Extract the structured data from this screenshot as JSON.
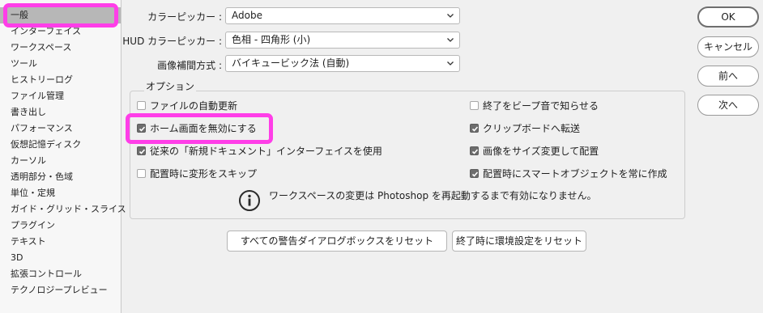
{
  "sidebar": {
    "items": [
      {
        "label": "一般",
        "selected": true
      },
      {
        "label": "インターフェイス"
      },
      {
        "label": "ワークスペース"
      },
      {
        "label": "ツール"
      },
      {
        "label": "ヒストリーログ"
      },
      {
        "label": "ファイル管理"
      },
      {
        "label": "書き出し"
      },
      {
        "label": "パフォーマンス"
      },
      {
        "label": "仮想記憶ディスク"
      },
      {
        "label": "カーソル"
      },
      {
        "label": "透明部分・色域"
      },
      {
        "label": "単位・定規"
      },
      {
        "label": "ガイド・グリッド・スライス"
      },
      {
        "label": "プラグイン"
      },
      {
        "label": "テキスト"
      },
      {
        "label": "3D"
      },
      {
        "label": "拡張コントロール"
      },
      {
        "label": "テクノロジープレビュー"
      }
    ]
  },
  "form": {
    "color_picker": {
      "label": "カラーピッカー :",
      "value": "Adobe"
    },
    "hud_color_picker": {
      "label": "HUD カラーピッカー :",
      "value": "色相 - 四角形 (小)"
    },
    "interpolation": {
      "label": "画像補間方式 :",
      "value": "バイキュービック法 (自動)"
    }
  },
  "options": {
    "legend": "オプション",
    "left": [
      {
        "label": "ファイルの自動更新",
        "checked": false
      },
      {
        "label": "ホーム画面を無効にする",
        "checked": true
      },
      {
        "label": "従来の「新規ドキュメント」インターフェイスを使用",
        "checked": true
      },
      {
        "label": "配置時に変形をスキップ",
        "checked": false
      }
    ],
    "right": [
      {
        "label": "終了をビープ音で知らせる",
        "checked": false
      },
      {
        "label": "クリップボードへ転送",
        "checked": true
      },
      {
        "label": "画像をサイズ変更して配置",
        "checked": true
      },
      {
        "label": "配置時にスマートオブジェクトを常に作成",
        "checked": true
      }
    ],
    "info": "ワークスペースの変更は Photoshop を再起動するまで有効になりません。"
  },
  "buttons": {
    "reset_warnings": "すべての警告ダイアログボックスをリセット",
    "reset_prefs": "終了時に環境設定をリセット",
    "ok": "OK",
    "cancel": "キャンセル",
    "prev": "前へ",
    "next": "次へ"
  },
  "colors": {
    "highlight": "#ff3ee8",
    "checked_box": "#6d6d6d",
    "selected_item": "#b7b7b7"
  }
}
